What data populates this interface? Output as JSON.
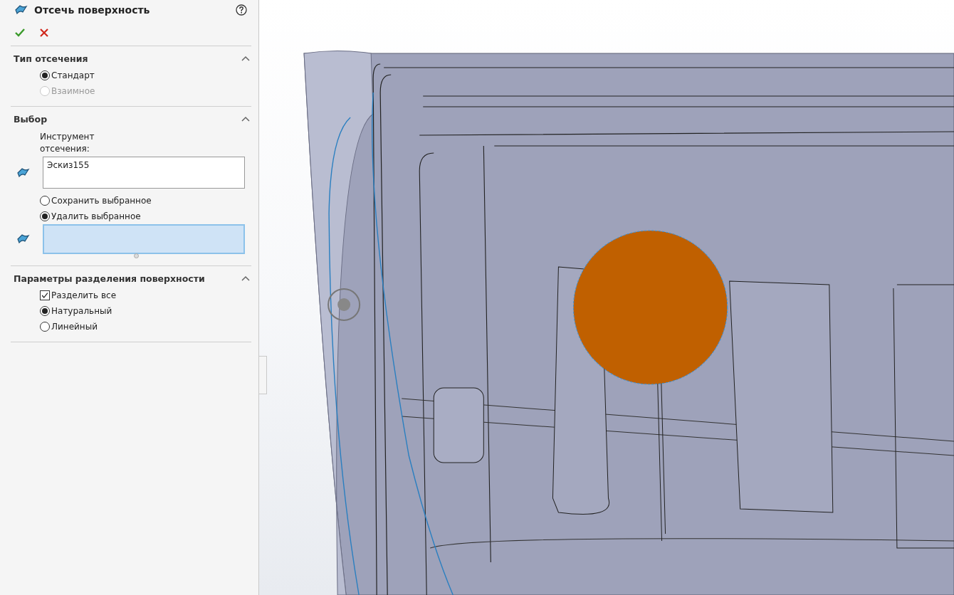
{
  "panel": {
    "title": "Отсечь поверхность",
    "sections": [
      {
        "title": "Тип отсечения",
        "expanded": true,
        "items": [
          {
            "kind": "radio",
            "label": "Стандарт",
            "selected": true,
            "disabled": false
          },
          {
            "kind": "radio",
            "label": "Взаимное",
            "selected": false,
            "disabled": true
          }
        ]
      },
      {
        "title": "Выбор",
        "expanded": true,
        "items": [
          {
            "kind": "label",
            "label": "Инструмент отсечения:"
          },
          {
            "kind": "field",
            "value": "Эскиз155",
            "active": false
          },
          {
            "kind": "radio",
            "label": "Сохранить выбранное",
            "selected": false,
            "disabled": false
          },
          {
            "kind": "radio",
            "label": "Удалить выбранное",
            "selected": true,
            "disabled": false
          },
          {
            "kind": "field",
            "value": "",
            "active": true
          }
        ]
      },
      {
        "title": "Параметры разделения поверхности",
        "expanded": true,
        "items": [
          {
            "kind": "checkbox",
            "label": "Разделить все",
            "checked": true
          },
          {
            "kind": "radio",
            "label": "Натуральный",
            "selected": true,
            "disabled": false
          },
          {
            "kind": "radio",
            "label": "Линейный",
            "selected": false,
            "disabled": false
          }
        ]
      }
    ]
  }
}
